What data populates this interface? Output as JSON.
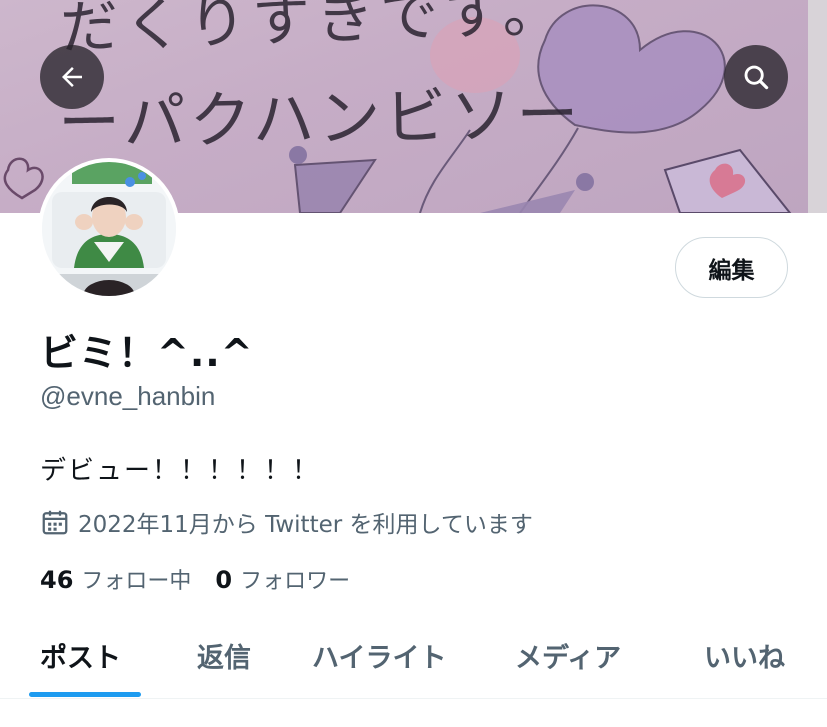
{
  "banner": {
    "line1": "だくりすきです。",
    "line2": "ーパクハンビソー"
  },
  "header": {
    "back_icon": "arrow-left-icon",
    "search_icon": "search-icon"
  },
  "profile": {
    "edit_label": "編集",
    "display_name": "ビミ！^..^",
    "handle": "@evne_hanbin",
    "bio": "デビュー！！！！！！",
    "joined": "2022年11月から Twitter を利用しています",
    "following_count": "46",
    "following_label": "フォロー中",
    "followers_count": "0",
    "followers_label": "フォロワー"
  },
  "tabs": [
    {
      "label": "ポスト",
      "active": true
    },
    {
      "label": "返信"
    },
    {
      "label": "ハイライト"
    },
    {
      "label": "メディア"
    },
    {
      "label": "いいね"
    }
  ],
  "colors": {
    "accent": "#1d9bf0",
    "secondary_text": "#536471",
    "primary_text": "#0f1419"
  }
}
